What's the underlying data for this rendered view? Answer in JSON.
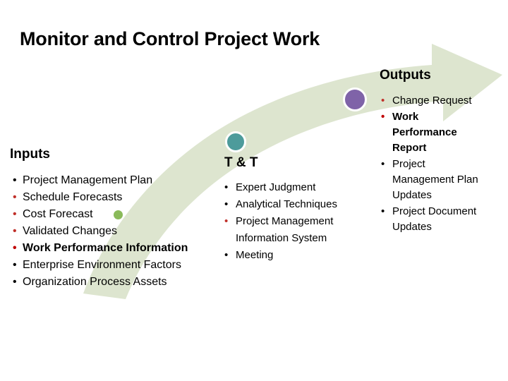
{
  "slide": {
    "title": "Monitor and Control Project Work",
    "background_color": "#ffffff"
  },
  "arrow": {
    "fill_color": "#dde5cf",
    "shape": "curved-rising-arrow"
  },
  "sections": {
    "inputs": {
      "heading": "Inputs",
      "items": [
        {
          "label": "Project Management Plan",
          "style": "normal"
        },
        {
          "label": "Schedule Forecasts",
          "style": "red"
        },
        {
          "label": "Cost Forecast",
          "style": "red"
        },
        {
          "label": "Validated Changes",
          "style": "red"
        },
        {
          "label": "Work Performance Information",
          "style": "redbold"
        },
        {
          "label": "Enterprise Environment Factors",
          "style": "normal"
        },
        {
          "label": "Organization Process Assets",
          "style": "normal"
        }
      ]
    },
    "tools_and_techniques": {
      "heading": "T & T",
      "items": [
        {
          "label": "Expert Judgment",
          "style": "normal"
        },
        {
          "label": "Analytical Techniques",
          "style": "normal"
        },
        {
          "label": "Project Management Information System",
          "style": "red"
        },
        {
          "label": "Meeting",
          "style": "normal"
        }
      ]
    },
    "outputs": {
      "heading": "Outputs",
      "items": [
        {
          "label": "Change Request",
          "style": "red"
        },
        {
          "label": "Work Performance Report",
          "style": "redbold"
        },
        {
          "label": "Project Management Plan Updates",
          "style": "normal"
        },
        {
          "label": "Project Document Updates",
          "style": "normal"
        }
      ]
    }
  },
  "milestones": [
    {
      "name": "inputs-milestone",
      "color": "#8aba5a"
    },
    {
      "name": "tools-milestone",
      "color": "#4d9b9b"
    },
    {
      "name": "outputs-milestone",
      "color": "#7f63a8"
    }
  ],
  "colors": {
    "red": "#c0302a",
    "red_bold": "#c00000",
    "arrow_green": "#dde5cf",
    "text": "#000000"
  },
  "bullet_glyph": "•"
}
